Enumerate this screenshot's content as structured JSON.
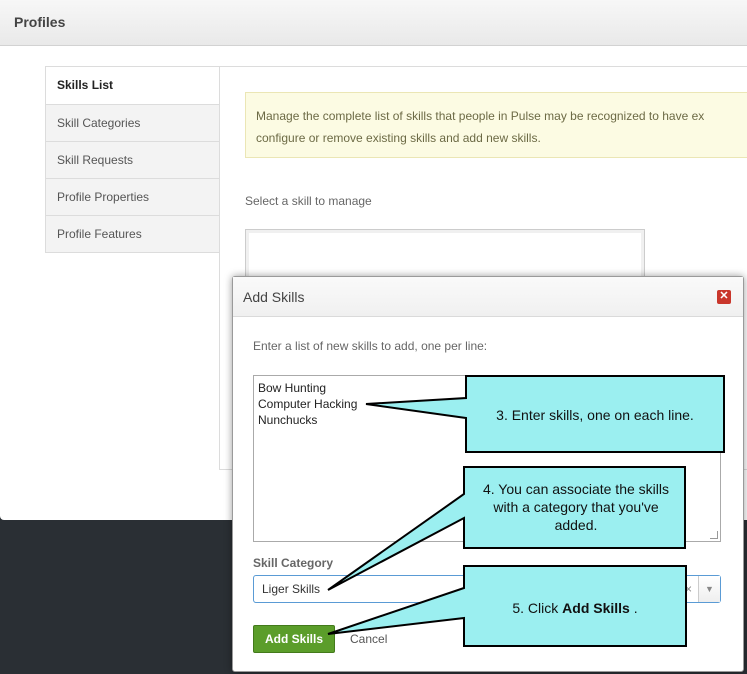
{
  "header": {
    "title": "Profiles"
  },
  "nav": {
    "items": [
      {
        "label": "Skills List",
        "active": true
      },
      {
        "label": "Skill Categories"
      },
      {
        "label": "Skill Requests"
      },
      {
        "label": "Profile Properties"
      },
      {
        "label": "Profile Features"
      }
    ]
  },
  "main": {
    "info_line1": "Manage the complete list of skills that people in Pulse may be recognized to have ex",
    "info_line2": "configure or remove existing skills and add new skills.",
    "select_label": "Select a skill to manage"
  },
  "modal": {
    "title": "Add Skills",
    "close_icon": "close-icon",
    "instructions": "Enter a list of new skills to add, one per line:",
    "skills": [
      "Bow Hunting",
      "Computer Hacking",
      "Nunchucks"
    ],
    "category_label": "Skill Category",
    "category_value": "Liger Skills",
    "clear_glyph": "×",
    "arrow_glyph": "▼",
    "add_button": "Add Skills",
    "cancel_link": "Cancel"
  },
  "callouts": {
    "c3": "3. Enter skills, one on each line.",
    "c4": "4. You can associate the skills with a category that you've added.",
    "c5_prefix": "5. Click ",
    "c5_bold": "Add Skills",
    "c5_suffix": " ."
  },
  "colors": {
    "callout_fill": "#9beff0",
    "add_button": "#5b9d2a",
    "close_button": "#c9362b",
    "info_bg": "#fcfbe3"
  }
}
